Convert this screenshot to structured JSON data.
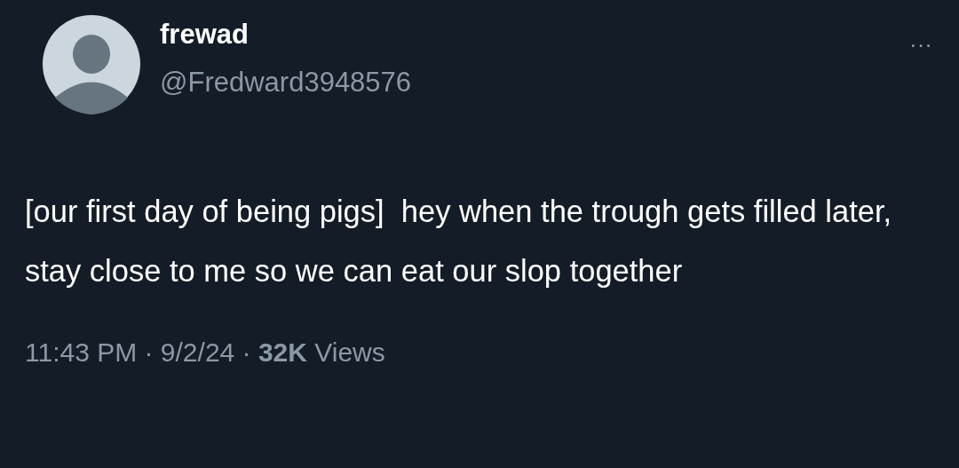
{
  "author": {
    "name": "frewad",
    "handle": "@Fredward3948576"
  },
  "more_menu": "···",
  "tweet": {
    "text": "[our first day of being pigs]  hey when the trough gets filled later, stay close to me so we can eat our slop together"
  },
  "meta": "11:43 PM · 9/2/24 · **32K** Views"
}
